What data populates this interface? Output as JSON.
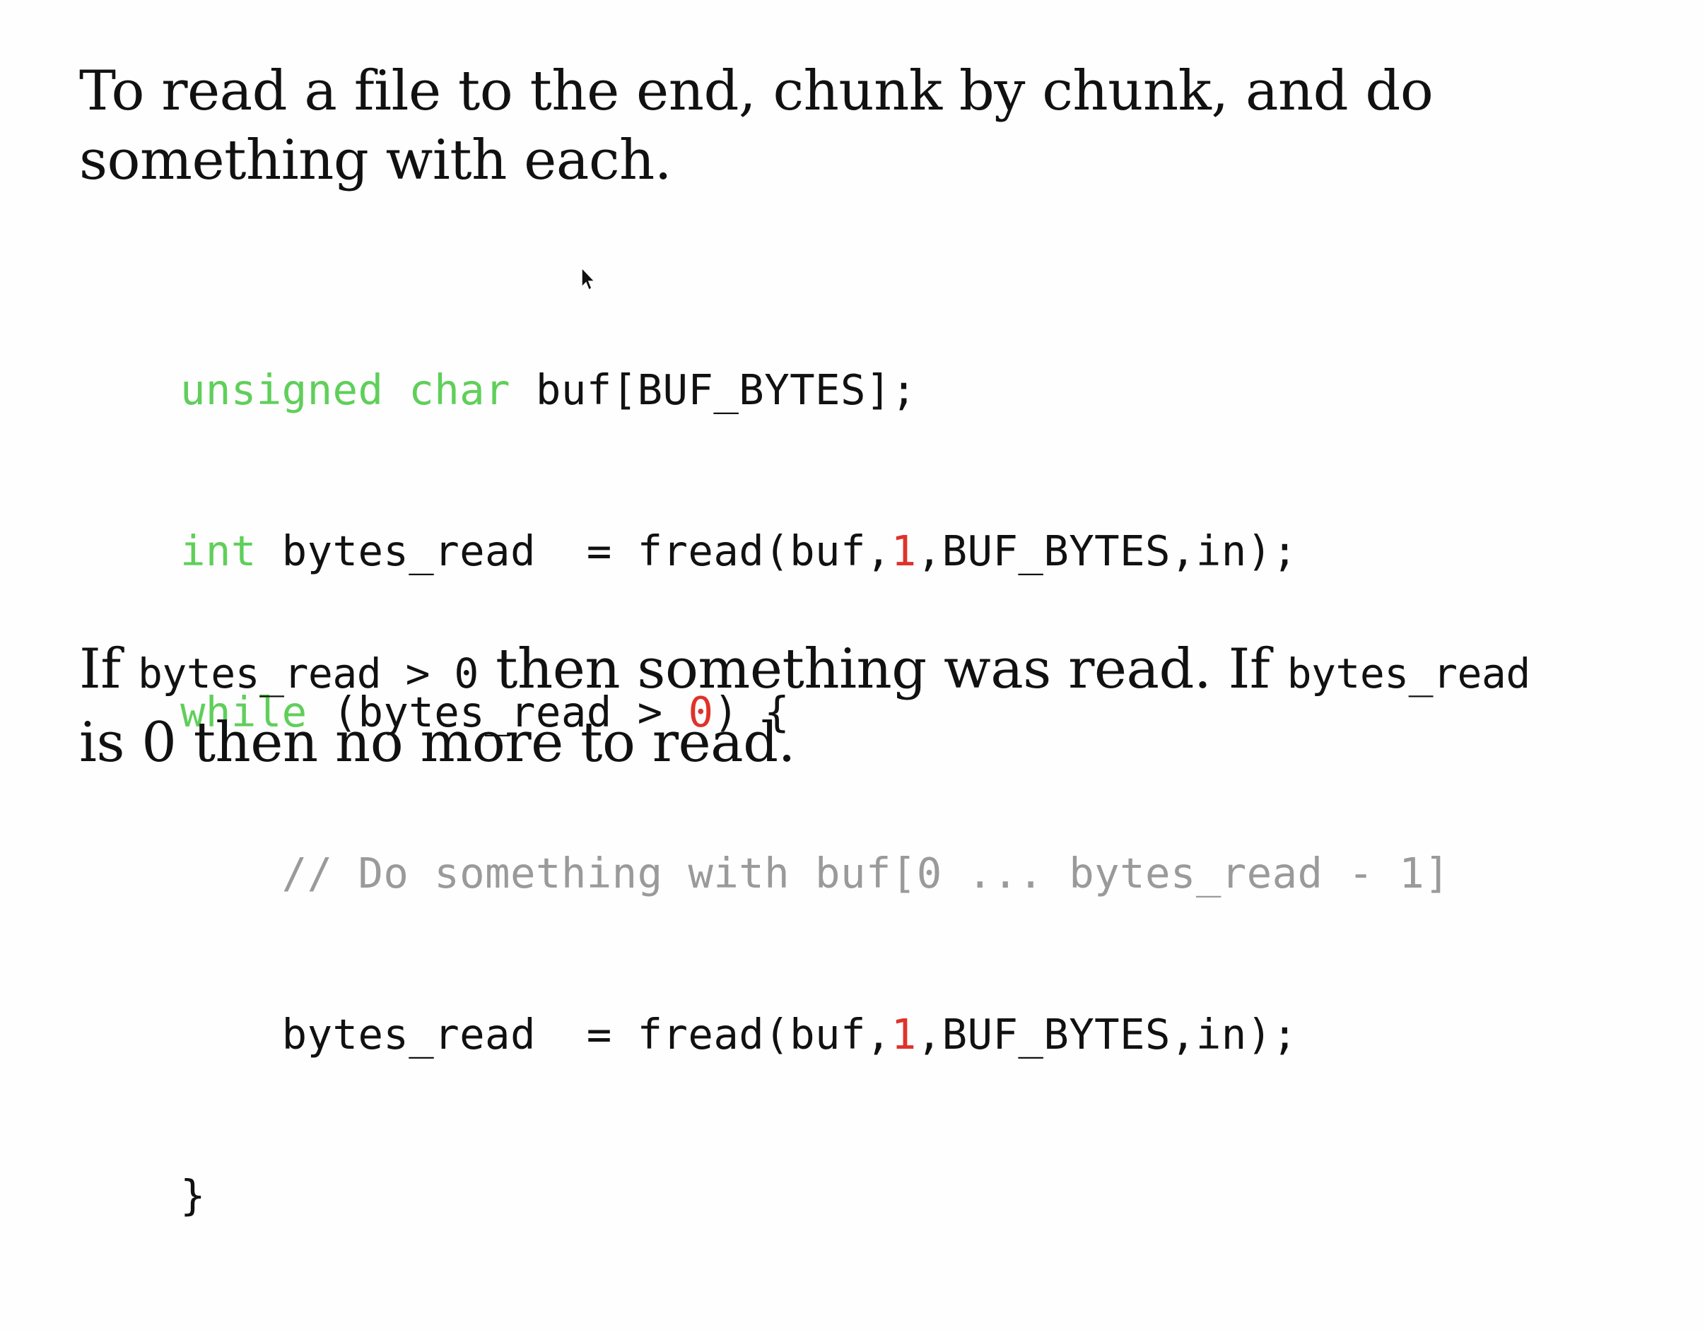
{
  "slide": {
    "intro": {
      "line1": "To read a file to the end, chunk by chunk, and do",
      "line2": "something with each."
    },
    "code": {
      "line1": {
        "kw1": "unsigned char",
        "rest": " buf[BUF_BYTES];"
      },
      "line2": {
        "kw": "int",
        "a": " bytes_read  = fread(buf,",
        "num": "1",
        "b": ",BUF_BYTES,in);"
      },
      "line3": {
        "kw": "while",
        "a": " (bytes_read > ",
        "num": "0",
        "b": ") {"
      },
      "line4": {
        "indent": "    ",
        "comment": "// Do something with buf[0 ... bytes_read - 1]"
      },
      "line5": {
        "a": "    bytes_read  = fread(buf,",
        "num": "1",
        "b": ",BUF_BYTES,in);"
      },
      "line6": {
        "a": "}"
      }
    },
    "outro": {
      "t1": "If ",
      "c1": "bytes_read > 0",
      "t2": " then something was read. If ",
      "c2": "bytes_read",
      "line2": "is 0 then no more to read."
    },
    "colors": {
      "keyword": "#5fcf5a",
      "number": "#e0322a",
      "comment": "#9a9a9a",
      "text": "#111111",
      "background": "#fefefe"
    },
    "icons": [
      "mouse-cursor-icon"
    ]
  }
}
